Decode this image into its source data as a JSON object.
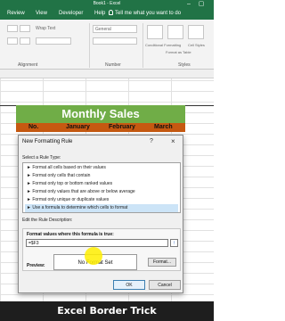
{
  "window": {
    "title": "Book1 - Excel"
  },
  "ribbon_tabs": [
    "Review",
    "View",
    "Developer",
    "Help"
  ],
  "tell_me": "Tell me what you want to do",
  "ribbon": {
    "wrap_text": "Wrap Text",
    "number_format": "General",
    "conditional_formatting": "Conditional Formatting",
    "format_as_table": "Format as Table",
    "cell_styles": "Cell Styles",
    "groups": [
      "Alignment",
      "Number",
      "Styles"
    ]
  },
  "sheet": {
    "title": "Monthly Sales",
    "headers": [
      "No.",
      "January",
      "February",
      "March"
    ],
    "title_color": "#70ad47",
    "header_color": "#c65911"
  },
  "dialog": {
    "title": "New Formatting Rule",
    "help": "?",
    "close": "×",
    "select_rule_type_label": "Select a Rule Type:",
    "rule_types": [
      "► Format all cells based on their values",
      "► Format only cells that contain",
      "► Format only top or bottom ranked values",
      "► Format only values that are above or below average",
      "► Format only unique or duplicate values",
      "► Use a formula to determine which cells to format"
    ],
    "selected_rule_index": 5,
    "edit_rule_label": "Edit the Rule Description:",
    "formula_label": "Format values where this formula is true:",
    "formula_value": "=$F3",
    "preview_label": "Preview:",
    "preview_text": "No Format Set",
    "format_button": "Format...",
    "ok_button": "OK",
    "cancel_button": "Cancel"
  },
  "caption": "Excel Border Trick",
  "colors": {
    "excel_green": "#217346",
    "highlight": "#ffee00"
  }
}
